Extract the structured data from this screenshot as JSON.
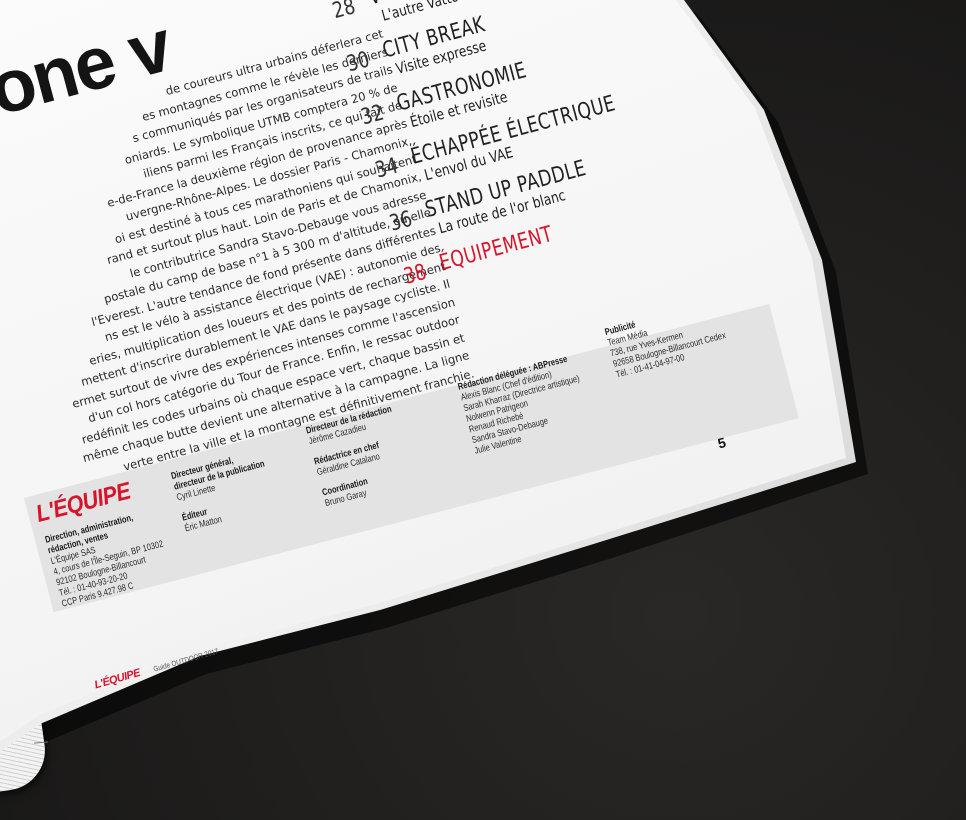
{
  "headline": "one v",
  "body_lines": [
    "de coureurs ultra urbains déferlera cet",
    "es montagnes comme le révèle les derniers",
    "s communiqués par les organisateurs de trails",
    "oniards. Le symbolique UTMB comptera 20 % de",
    "iliens parmi les Français inscrits, ce qui fait de",
    "e-de-France la deuxième région de provenance après",
    "uvergne-Rhône-Alpes. Le dossier Paris - Chamonix,",
    "oi est destiné à tous ces marathoniens qui souhaitent",
    "rand et surtout plus haut. Loin de Paris et de Chamonix,",
    "le contributrice Sandra Stavo-Debauge vous adresse",
    "postale du camp de base n°1 à 5 300 m d'altitude, où elle",
    "l'Everest. L'autre tendance de fond présente dans différentes",
    "ns est le vélo à assistance électrique (VAE) : autonomie des",
    "eries, multiplication des loueurs et des points de rechargement",
    "mettent d'inscrire durablement le VAE dans le paysage cycliste. Il",
    "ermet surtout de vivre des expériences intenses comme l'ascension",
    "d'un col hors catégorie du Tour de France. Enfin, le ressac outdoor",
    "redéfinit les codes urbains où chaque espace vert, chaque bassin et",
    "même chaque butte devient une alternative à la campagne. La ligne",
    "verte entre la ville et la montagne est définitivement franchie."
  ],
  "toc": [
    {
      "num": "28",
      "title": "V",
      "subtitle": "L'autre Vatto",
      "highlight": false
    },
    {
      "num": "30",
      "title": "City break",
      "subtitle": "Visite expresse",
      "highlight": false
    },
    {
      "num": "32",
      "title": "Gastronomie",
      "subtitle": "Étoile et revisite",
      "highlight": false
    },
    {
      "num": "34",
      "title": "Échappée électrique",
      "subtitle": "L'envol du VAE",
      "highlight": false
    },
    {
      "num": "36",
      "title": "Stand up paddle",
      "subtitle": "La route de l'or blanc",
      "highlight": false
    },
    {
      "num": "38",
      "title": "Équipement",
      "subtitle": "",
      "highlight": true
    }
  ],
  "credits": {
    "logo": "L'ÉQUIPE",
    "direction_label": "Direction, administration, rédaction, ventes",
    "direction_lines": [
      "L'Équipe SAS",
      "4, cours de l'Île-Seguin, BP 10302",
      "92102 Boulogne-Billancourt",
      "Tél. : 01-40-93-20-20",
      "CCP Paris 9.427.98 C"
    ],
    "dg_label": "Directeur général, directeur de la publication",
    "dg_name": "Cyril Linette",
    "editeur_label": "Éditeur",
    "editeur_name": "Éric Matton",
    "dir_redac_label": "Directeur de la rédaction",
    "dir_redac_name": "Jérôme Cazadieu",
    "redac_chef_label": "Rédactrice en chef",
    "redac_chef_name": "Géraldine Catalano",
    "coord_label": "Coordination",
    "coord_name": "Bruno Garay",
    "deleguee_label": "Rédaction déléguée : ABPresse",
    "deleguee_lines": [
      "Alexis Blanc (Chef d'édition)",
      "Sarah Kharraz (Directrice artistique)",
      "Nolwenn Patrigeon",
      "Renaud Richebé",
      "Sandra Stavo-Debauge",
      "Julie Valentine"
    ],
    "pub_label": "Publicité",
    "pub_lines": [
      "Team Média",
      "738, rue Yves-Kermen",
      "92658 Boulogne-Billancourt Cedex",
      "Tél. : 01-41-04-97-00"
    ]
  },
  "page_number": "5",
  "footer": {
    "logo": "L'ÉQUIPE",
    "text": "Guide OUTDOOR 2017"
  },
  "colors": {
    "accent": "#d8142a",
    "ink": "#1a1a1a",
    "paper": "#f6f6f6",
    "credit_band": "#e3e3e3",
    "background": "#1c1b1a"
  }
}
